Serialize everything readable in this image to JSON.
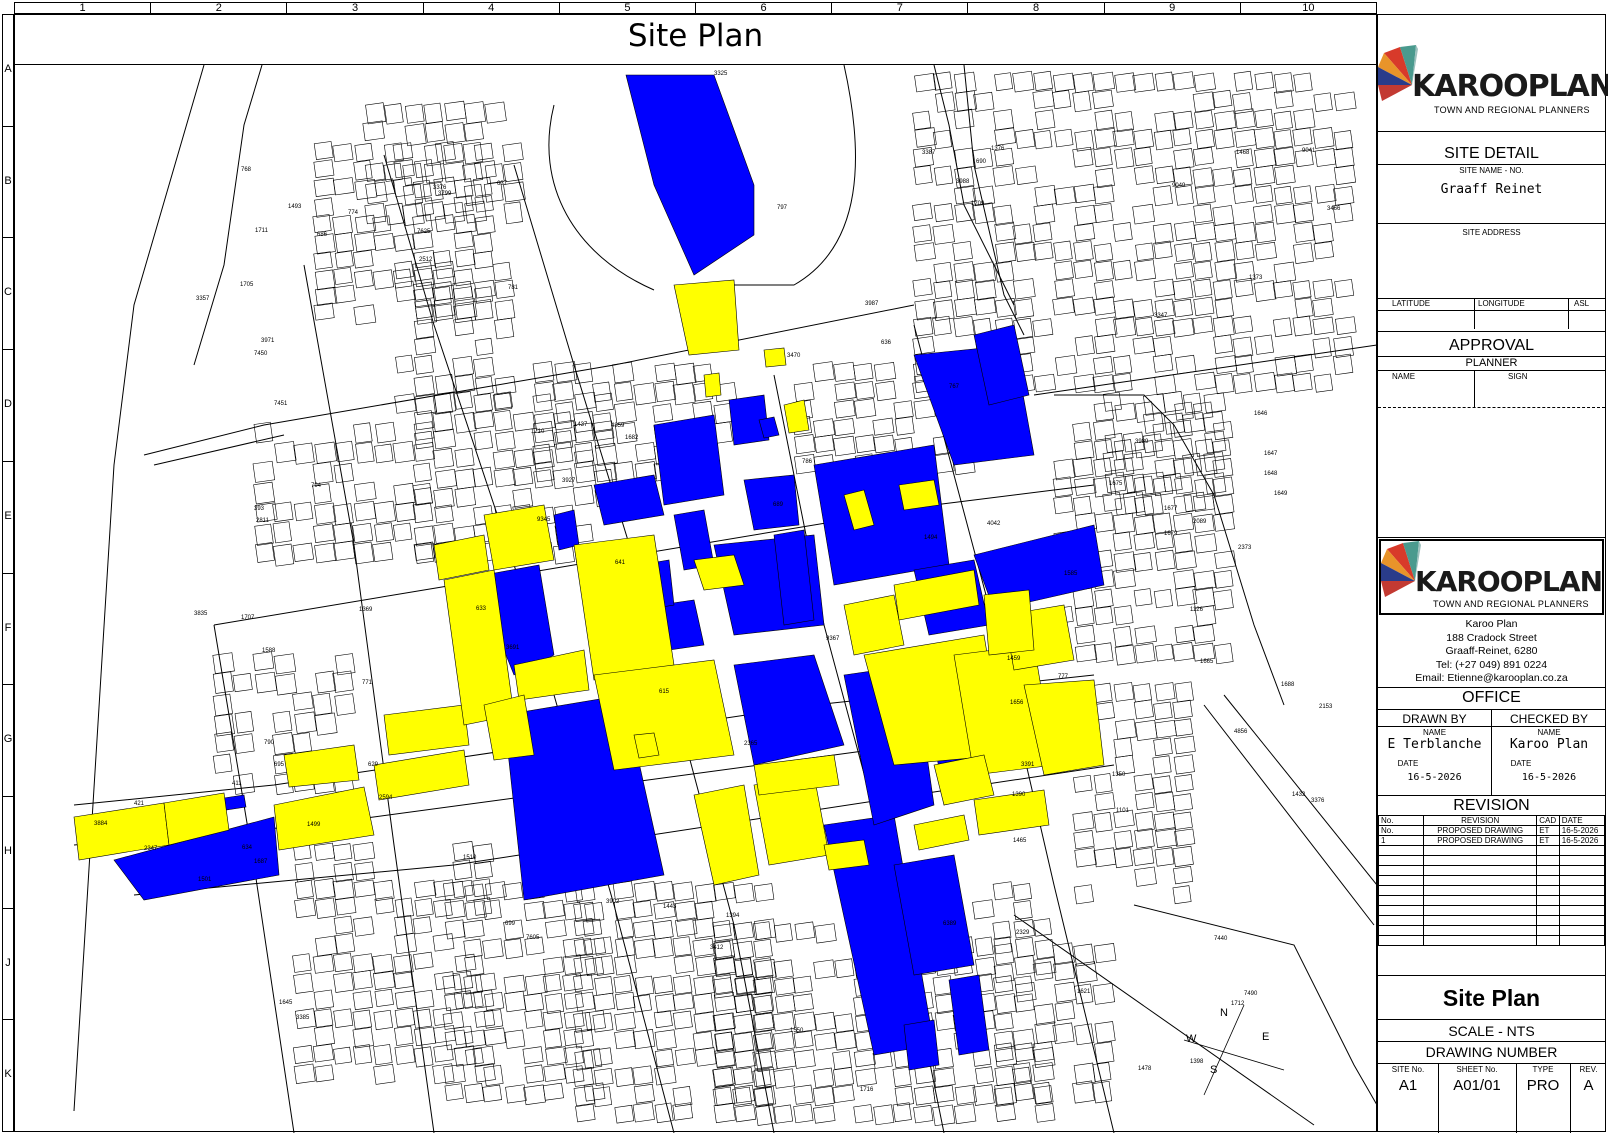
{
  "ruler": {
    "columns": [
      "1",
      "2",
      "3",
      "4",
      "5",
      "6",
      "7",
      "8",
      "9",
      "10"
    ],
    "rows": [
      "A",
      "B",
      "C",
      "D",
      "E",
      "F",
      "G",
      "H",
      "J",
      "K"
    ]
  },
  "map": {
    "title": "Site Plan",
    "colors": {
      "highlight_yellow": "#ffff00",
      "highlight_blue": "#0000ff",
      "lines": "#000000"
    },
    "plot_labels": [
      "3325",
      "7450",
      "7451",
      "393",
      "3835",
      "411",
      "421",
      "3884",
      "2347",
      "7440",
      "7490",
      "1646",
      "1647",
      "1648",
      "1649",
      "1679",
      "1677",
      "1675",
      "1656",
      "1665",
      "1645",
      "3799",
      "1682",
      "1621",
      "1687",
      "1709",
      "1710",
      "1716",
      "1705",
      "1707",
      "1711",
      "1712",
      "3902",
      "2373",
      "2365",
      "9367",
      "4859",
      "2594",
      "9041",
      "9049",
      "9345",
      "4856",
      "3387",
      "7625",
      "3391",
      "1588",
      "2512",
      "1585",
      "1550",
      "6389",
      "3927",
      "3691",
      "1126",
      "1101",
      "1390",
      "1369",
      "1394",
      "1499",
      "1373",
      "1376",
      "1398",
      "1443",
      "1350",
      "1510",
      "1501",
      "1493",
      "1494",
      "2811",
      "2153",
      "1437",
      "1468",
      "1459",
      "1465",
      "1478",
      "767",
      "768",
      "771",
      "774",
      "777",
      "781",
      "786",
      "790",
      "797",
      "794",
      "615",
      "629",
      "633",
      "634",
      "636",
      "637",
      "641",
      "686",
      "689",
      "690",
      "695",
      "699",
      "7605",
      "3347",
      "1432",
      "3987",
      "3988",
      "3989",
      "2089",
      "1688",
      "3376",
      "3412",
      "3466",
      "3470",
      "2329",
      "3385",
      "3357",
      "3376",
      "4042",
      "3971"
    ],
    "compass": {
      "n": "N",
      "w": "W",
      "e": "E",
      "s": "S"
    }
  },
  "titleblock": {
    "logo": {
      "name": "KAROOPLAN",
      "tagline": "TOWN AND REGIONAL PLANNERS"
    },
    "site_detail": {
      "heading": "SITE DETAIL",
      "site_name_label": "SITE NAME - NO.",
      "site_name": "Graaff Reinet",
      "site_address_label": "SITE ADDRESS",
      "site_address": "",
      "latitude_label": "LATITUDE",
      "longitude_label": "LONGITUDE",
      "asl_label": "ASL"
    },
    "approval": {
      "heading": "APPROVAL",
      "planner_label": "PLANNER",
      "name_label": "NAME",
      "sign_label": "SIGN"
    },
    "office": {
      "company": "Karoo Plan",
      "street": "188 Cradock Street",
      "town": "Graaff-Reinet, 6280",
      "tel": "Tel: (+27 049) 891 0224",
      "email": "Email: Etienne@karooplan.co.za",
      "heading": "OFFICE"
    },
    "drawn_by": {
      "label": "DRAWN BY",
      "name_label": "NAME",
      "name": "E Terblanche",
      "date_label": "DATE",
      "date": "16-5-2026"
    },
    "checked_by": {
      "label": "CHECKED BY",
      "name_label": "NAME",
      "name": "Karoo Plan",
      "date_label": "DATE",
      "date": "16-5-2026"
    },
    "revision": {
      "heading": "REVISION",
      "columns": [
        "No.",
        "REVISION",
        "CAD",
        "DATE"
      ],
      "rows": [
        [
          "No.",
          "PROPOSED DRAWING",
          "ET",
          "16-5-2026"
        ],
        [
          "1",
          "PROPOSED DRAWING",
          "ET",
          "16-5-2026"
        ]
      ],
      "blank_rows": 10
    },
    "drawing": {
      "title": "Site Plan",
      "scale": "SCALE - NTS",
      "number_label": "DRAWING NUMBER",
      "site_no_label": "SITE No.",
      "site_no": "A1",
      "sheet_no_label": "SHEET No.",
      "sheet_no": "A01/01",
      "type_label": "TYPE",
      "type": "PRO",
      "rev_label": "REV.",
      "rev": "A"
    }
  }
}
